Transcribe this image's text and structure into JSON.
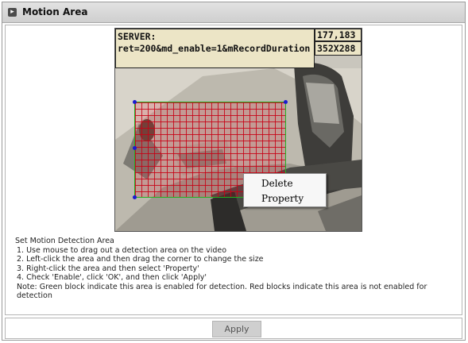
{
  "panel": {
    "title": "Motion Area",
    "title_icon": "chevron-right-icon"
  },
  "video": {
    "server_label": "SERVER:",
    "server_response": "ret=200&md_enable=1&mRecordDuration",
    "cursor_coords": "177,183",
    "resolution": "352X288",
    "detection_grid_color": "#cc0014",
    "enabled_border_color": "#22b022",
    "context_menu": {
      "items": [
        "Delete",
        "Property"
      ]
    }
  },
  "instructions": {
    "heading": "Set Motion Detection Area",
    "steps": [
      "1. Use mouse to drag out a detection area on the video",
      "2. Left-click the area and then drag the corner to change the size",
      "3. Right-click the area and then select 'Property'",
      "4. Check 'Enable', click 'OK', and then click 'Apply'"
    ],
    "note": "Note: Green block indicate this area is enabled for detection. Red blocks indicate this area is not enabled for detection"
  },
  "footer": {
    "apply_label": "Apply"
  }
}
